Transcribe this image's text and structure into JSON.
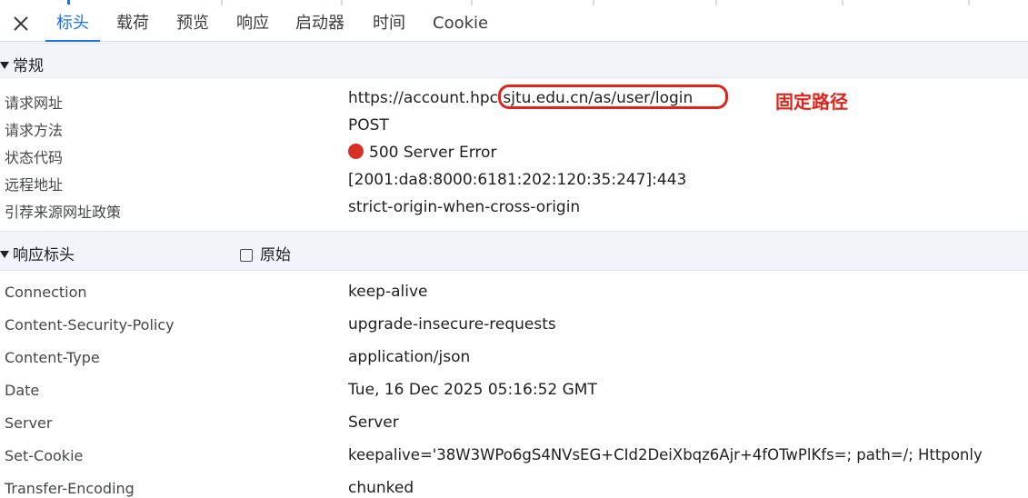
{
  "tabs": [
    "标头",
    "载荷",
    "预览",
    "响应",
    "启动器",
    "时间",
    "Cookie"
  ],
  "active_tab": "标头",
  "accent_color": "#1a73e8",
  "close_icon": "close-icon",
  "general": {
    "title": "常规",
    "rows": [
      {
        "label": "请求网址",
        "value": "https://account.hpc.sjtu.edu.cn/as/user/login"
      },
      {
        "label": "请求方法",
        "value": "POST"
      },
      {
        "label": "状态代码",
        "value": "500 Server Error"
      },
      {
        "label": "远程地址",
        "value": "[2001:da8:8000:6181:202:120:35:247]:443"
      },
      {
        "label": "引荐来源网址政策",
        "value": "strict-origin-when-cross-origin"
      }
    ]
  },
  "response_headers": {
    "title": "响应标头",
    "raw_label": "原始",
    "raw_checked": false,
    "rows": [
      {
        "label": "Connection",
        "value": "keep-alive"
      },
      {
        "label": "Content-Security-Policy",
        "value": "upgrade-insecure-requests"
      },
      {
        "label": "Content-Type",
        "value": "application/json"
      },
      {
        "label": "Date",
        "value": "Tue, 16 Dec 2025 05:16:52 GMT"
      },
      {
        "label": "Server",
        "value": "Server"
      },
      {
        "label": "Set-Cookie",
        "value": "keepalive='38W3WPo6gS4NVsEG+CId2DeiXbqz6Ajr+4fOTwPlKfs=; path=/; Httponly"
      },
      {
        "label": "Transfer-Encoding",
        "value": "chunked"
      }
    ]
  },
  "status_color": "#d93025",
  "annotation": {
    "text": "固定路径",
    "color": "#e2231a"
  }
}
